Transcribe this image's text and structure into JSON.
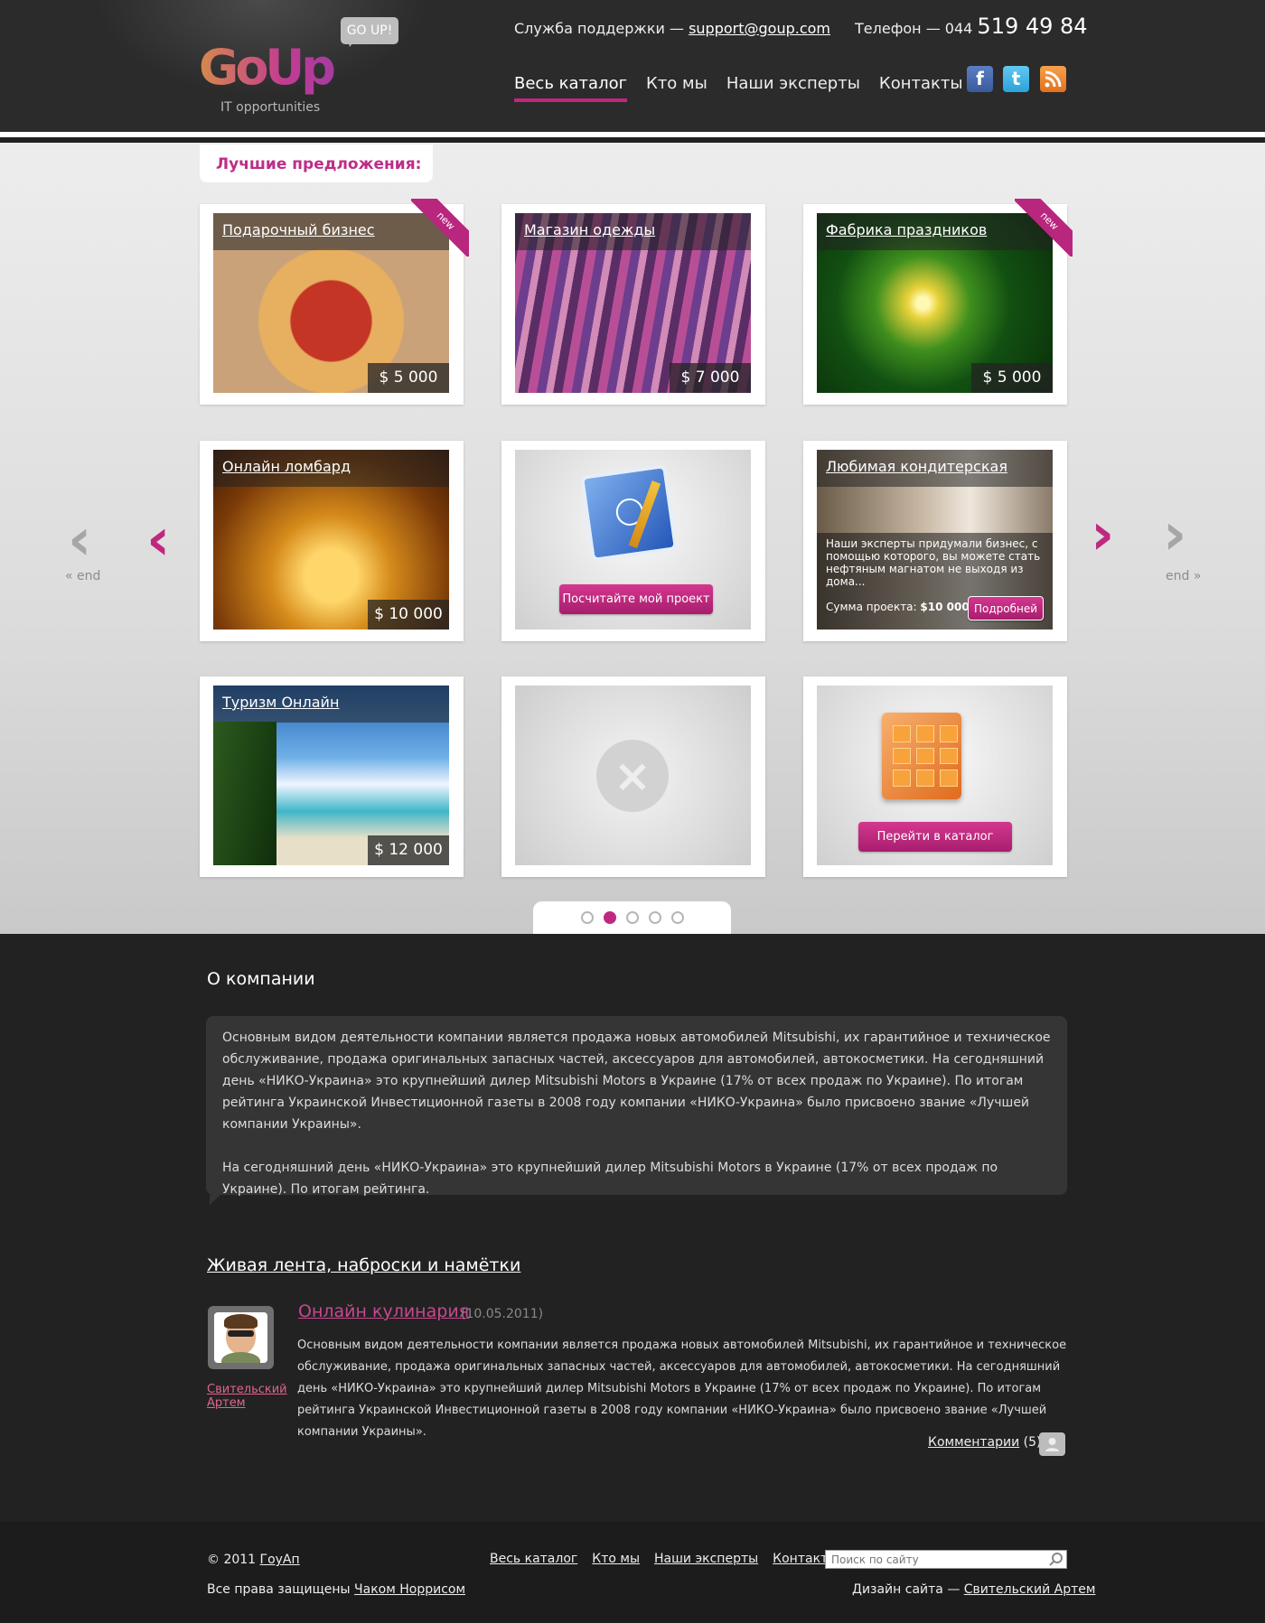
{
  "header": {
    "logo_text": "GoUp",
    "tagline": "IT opportunities",
    "bubble": "GO UP!",
    "support_label": "Служба поддержки —",
    "support_email": "support@goup.com",
    "phone_label": "Телефон — 044",
    "phone_number": "519 49 84",
    "nav": [
      "Весь каталог",
      "Кто мы",
      "Наши эксперты",
      "Контакты"
    ],
    "social": [
      "facebook-icon",
      "twitter-icon",
      "rss-icon"
    ]
  },
  "offers": {
    "title": "Лучшие предложения:",
    "cards": [
      {
        "title": "Подарочный бизнес",
        "price": "$ 5 000",
        "badge": "new"
      },
      {
        "title": "Магазин одежды",
        "price": "$ 7 000"
      },
      {
        "title": "Фабрика праздников",
        "price": "$ 5 000",
        "badge": "new"
      },
      {
        "title": "Онлайн ломбард",
        "price": "$ 10 000"
      },
      {
        "button": "Посчитайте мой проект"
      },
      {
        "title": "Любимая кондитерская",
        "description": "Наши эксперты придумали бизнес, с помощью которого, вы можете стать нефтяным магнатом не выходя из дома...",
        "sum_label": "Сумма проекта:",
        "sum_value": "$10 000",
        "button": "Подробней"
      },
      {
        "title": "Туризм Онлайн",
        "price": "$ 12 000"
      },
      {},
      {
        "button": "Перейти в каталог"
      }
    ],
    "end_left": "« end",
    "end_right": "end »",
    "pages": 5,
    "active_page": 2
  },
  "about": {
    "heading": "О компании",
    "paragraphs": [
      "Основным видом деятельности компании является продажа новых автомобилей Mitsubishi, их гарантийное и техническое обслуживание, продажа оригинальных запасных частей, аксессуаров для автомобилей, автокосметики. На сегодняшний день «НИКО-Украина» это крупнейший дилер Mitsubishi Motors в Украине (17% от всех продаж по Украине). По итогам рейтинга Украинской Инвестиционной газеты в 2008 году компании «НИКО-Украина» было присвоено звание «Лучшей компании Украины».",
      "На сегодняшний день «НИКО-Украина» это крупнейший дилер Mitsubishi Motors в Украине (17% от всех продаж по Украине). По итогам рейтинга."
    ]
  },
  "feed": {
    "heading": "Живая лента, наброски и намётки",
    "post": {
      "author": "Свительский Артем",
      "title": "Онлайн кулинария",
      "date": "(10.05.2011)",
      "text": "Основным видом деятельности компании является продажа новых автомобилей Mitsubishi, их гарантийное и техническое обслуживание, продажа оригинальных запасных частей, аксессуаров для автомобилей, автокосметики. На сегодняшний день «НИКО-Украина» это крупнейший дилер Mitsubishi Motors в Украине (17% от всех продаж по Украине). По итогам рейтинга Украинской Инвестиционной газеты в 2008 году компании «НИКО-Украина» было присвоено звание «Лучшей компании Украины».",
      "comments_label": "Комментарии",
      "comments_count": "(5)"
    }
  },
  "footer": {
    "copyright": "© 2011",
    "copyright_link": "ГоуАп",
    "rights": "Все права защищены",
    "rights_link": "Чаком Норрисом",
    "nav": [
      "Весь каталог",
      "Кто мы",
      "Наши эксперты",
      "Контакты"
    ],
    "search_placeholder": "Поиск по сайту",
    "design_label": "Дизайн сайта —",
    "design_link": "Свительский Артем"
  },
  "colors": {
    "accent": "#c0287f",
    "dark": "#262626",
    "light": "#e5e5e5"
  }
}
